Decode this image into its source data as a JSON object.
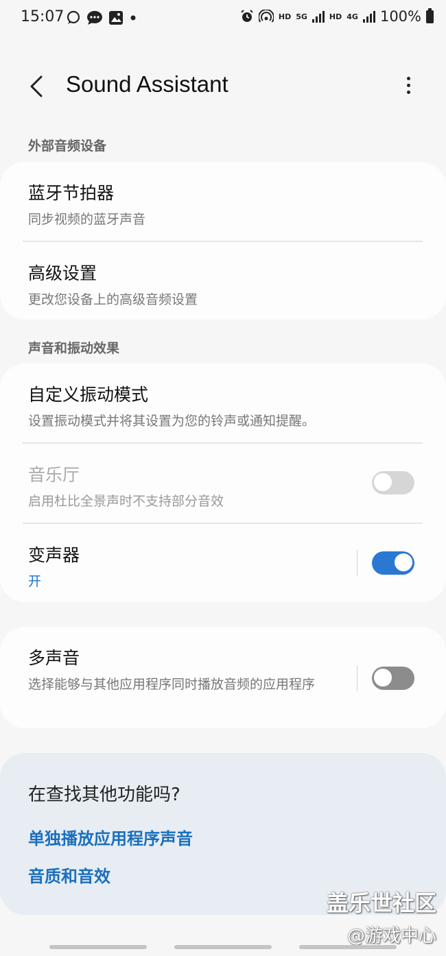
{
  "status_bar": {
    "time": "15:07",
    "left_icons": [
      "chat-bubble-icon",
      "message-icon",
      "gallery-icon",
      "dot-icon"
    ],
    "network_hd_1": "HD",
    "network_5g": "5G",
    "network_hd_2": "HD",
    "network_4g": "4G",
    "battery": "100%"
  },
  "header": {
    "title": "Sound Assistant"
  },
  "sections": {
    "external_audio": {
      "label": "外部音频设备",
      "items": [
        {
          "title": "蓝牙节拍器",
          "subtitle": "同步视频的蓝牙声音"
        },
        {
          "title": "高级设置",
          "subtitle": "更改您设备上的高级音频设置"
        }
      ]
    },
    "sound_effects": {
      "label": "声音和振动效果",
      "items": [
        {
          "title": "自定义振动模式",
          "subtitle": "设置振动模式并将其设置为您的铃声或通知提醒。"
        },
        {
          "title": "音乐厅",
          "subtitle": "启用杜比全景声时不支持部分音效",
          "toggle": "off",
          "enabled": false
        },
        {
          "title": "变声器",
          "subtitle": "开",
          "toggle": "on",
          "enabled": true
        }
      ]
    },
    "multi_sound": {
      "title": "多声音",
      "subtitle": "选择能够与其他应用程序同时播放音频的应用程序",
      "toggle": "off"
    }
  },
  "suggestions": {
    "title": "在查找其他功能吗?",
    "links": [
      "单独播放应用程序声音",
      "音质和音效"
    ]
  },
  "watermark": {
    "line1": "盖乐世社区",
    "line2": "@游戏中心"
  },
  "colors": {
    "accent": "#2a78d2",
    "link": "#1a6fbe",
    "background": "#f6f6f6",
    "card": "#fdfdfd",
    "suggestion_bg": "#e7edf3"
  }
}
